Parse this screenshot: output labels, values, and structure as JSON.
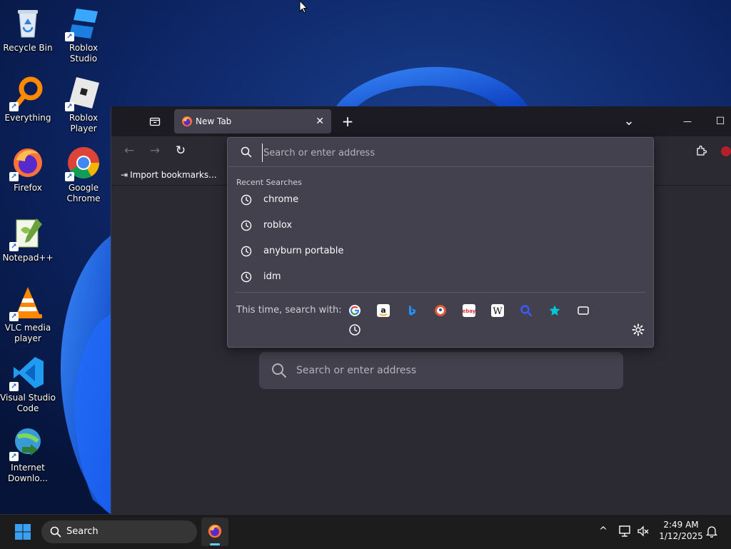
{
  "desktop": {
    "icons": [
      {
        "label": "Recycle Bin",
        "icon": "recycle-bin-icon"
      },
      {
        "label": "Roblox Studio",
        "icon": "roblox-studio-icon"
      },
      {
        "label": "Everything",
        "icon": "everything-search-icon"
      },
      {
        "label": "Roblox Player",
        "icon": "roblox-player-icon"
      },
      {
        "label": "Firefox",
        "icon": "firefox-icon"
      },
      {
        "label": "Google Chrome",
        "icon": "chrome-icon"
      },
      {
        "label": "Notepad++",
        "icon": "notepad-plus-plus-icon"
      },
      {
        "label": "VLC media player",
        "icon": "vlc-icon"
      },
      {
        "label": "Visual Studio Code",
        "icon": "vscode-icon"
      },
      {
        "label": "Internet Downlo...",
        "icon": "idm-icon"
      }
    ]
  },
  "browser": {
    "tab": {
      "title": "New Tab",
      "close_glyph": "✕"
    },
    "new_tab_glyph": "+",
    "list_all_tabs_glyph": "⌄",
    "window_controls": {
      "minimize": "—",
      "maximize": "☐"
    },
    "nav": {
      "back": "←",
      "forward": "→",
      "reload": "↻"
    },
    "bookmarks_bar": {
      "import_label": "Import bookmarks..."
    },
    "new_tab_page": {
      "search_placeholder": "Search or enter address"
    }
  },
  "urlbar_popup": {
    "input_placeholder": "Search or enter address",
    "input_value": "",
    "recent_heading": "Recent Searches",
    "recent_searches": [
      "chrome",
      "roblox",
      "anyburn portable",
      "idm"
    ],
    "search_with_label": "This time, search with:",
    "engines": [
      "google-icon",
      "amazon-icon",
      "bing-icon",
      "duckduckgo-icon",
      "ebay-icon",
      "wikipedia-icon",
      "perplexity-icon",
      "bookmarks-icon",
      "tabs-icon",
      "history-icon"
    ]
  },
  "taskbar": {
    "search_label": "Search",
    "time": "2:49 AM",
    "date": "1/12/2025"
  },
  "colors": {
    "window_bg": "#2b2a33",
    "tabbar_bg": "#1c1b22",
    "popup_bg": "#42414d",
    "taskbar_bg": "#1c1c1c"
  }
}
